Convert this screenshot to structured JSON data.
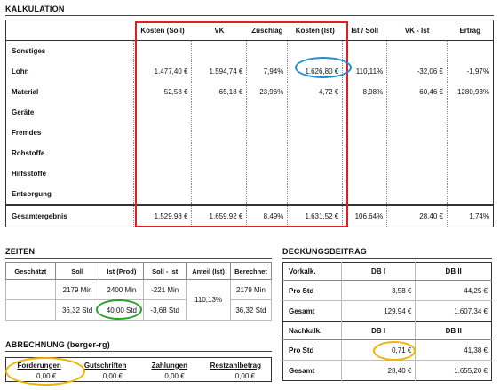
{
  "kalkulation": {
    "title": "KALKULATION",
    "headers": [
      "",
      "Kosten (Soll)",
      "VK",
      "Zuschlag",
      "Kosten (Ist)",
      "Ist / Soll",
      "VK - Ist",
      "Ertrag"
    ],
    "rows": [
      {
        "label": "Sonstiges",
        "cells": [
          "",
          "",
          "",
          "",
          "",
          "",
          ""
        ]
      },
      {
        "label": "Lohn",
        "cells": [
          "1.477,40 €",
          "1.594,74 €",
          "7,94%",
          "1.626,80 €",
          "110,11%",
          "-32,06 €",
          "-1,97%"
        ]
      },
      {
        "label": "Material",
        "cells": [
          "52,58 €",
          "65,18 €",
          "23,96%",
          "4,72 €",
          "8,98%",
          "60,46 €",
          "1280,93%"
        ]
      },
      {
        "label": "Geräte",
        "cells": [
          "",
          "",
          "",
          "",
          "",
          "",
          ""
        ]
      },
      {
        "label": "Fremdes",
        "cells": [
          "",
          "",
          "",
          "",
          "",
          "",
          ""
        ]
      },
      {
        "label": "Rohstoffe",
        "cells": [
          "",
          "",
          "",
          "",
          "",
          "",
          ""
        ]
      },
      {
        "label": "Hilfsstoffe",
        "cells": [
          "",
          "",
          "",
          "",
          "",
          "",
          ""
        ]
      },
      {
        "label": "Entsorgung",
        "cells": [
          "",
          "",
          "",
          "",
          "",
          "",
          ""
        ]
      }
    ],
    "total": {
      "label": "Gesamtergebnis",
      "cells": [
        "1.529,98 €",
        "1.659,92 €",
        "8,49%",
        "1.631,52 €",
        "106,64%",
        "28,40 €",
        "1,74%"
      ]
    }
  },
  "zeiten": {
    "title": "ZEITEN",
    "headers": [
      "Geschätzt",
      "Soll",
      "Ist (Prod)",
      "Soll - Ist",
      "Anteil (Ist)",
      "Berechnet"
    ],
    "row1": {
      "soll": "2179 Min",
      "ist": "2400 Min",
      "diff": "-221 Min",
      "anteil": "110,13%",
      "berechnet": "2179 Min"
    },
    "row2": {
      "soll": "36,32 Std",
      "ist": "40,00 Std",
      "diff": "-3,68 Std",
      "berechnet": "36,32 Std"
    }
  },
  "deckungsbeitrag": {
    "title": "DECKUNGSBEITRAG",
    "vorkalk": {
      "label": "Vorkalk.",
      "col1": "DB I",
      "col2": "DB II",
      "rows": [
        {
          "label": "Pro Std",
          "db1": "3,58 €",
          "db2": "44,25 €"
        },
        {
          "label": "Gesamt",
          "db1": "129,94 €",
          "db2": "1.607,34 €"
        }
      ]
    },
    "nachkalk": {
      "label": "Nachkalk.",
      "col1": "DB I",
      "col2": "DB II",
      "rows": [
        {
          "label": "Pro Std",
          "db1": "0,71 €",
          "db2": "41,38 €"
        },
        {
          "label": "Gesamt",
          "db1": "28,40 €",
          "db2": "1.655,20 €"
        }
      ]
    }
  },
  "abrechnung": {
    "title": "ABRECHNUNG (berger-rg)",
    "headers": [
      "Forderungen",
      "Gutschriften",
      "Zahlungen",
      "Restzahlbetrag"
    ],
    "values": [
      "0,00 €",
      "0,00 €",
      "0,00 €",
      "0,00 €"
    ]
  },
  "colors": {
    "red_highlight": "#e02020",
    "blue_circle": "#1e90d0",
    "green_circle": "#2ca02c",
    "yellow_circle": "#f0b400"
  }
}
